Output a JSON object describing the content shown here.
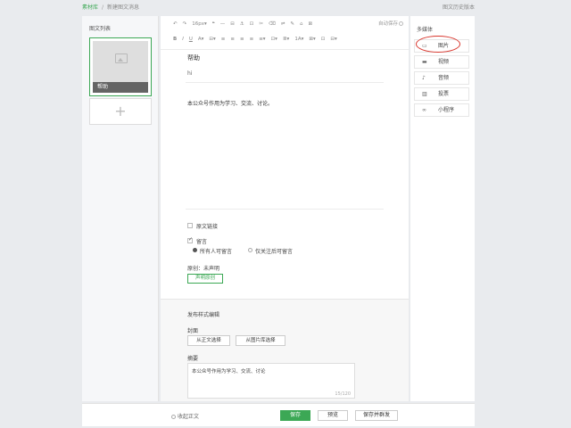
{
  "breadcrumb": {
    "root": "素材库",
    "separator": "/",
    "current": "新建图文消息"
  },
  "history_link": "图文历史版本",
  "left_panel": {
    "title": "图文列表",
    "thumb_label": "帮助",
    "add_symbol": "+"
  },
  "toolbar": {
    "row1": [
      "↶",
      "↷",
      "16px▾",
      "❝",
      "—",
      "⊟",
      "⚓",
      "⊡",
      "✂",
      "⌫",
      "⇌",
      "✎",
      "⌂",
      "⊠"
    ],
    "row2": [
      "B",
      "I",
      "U",
      "A▾",
      "⊟▾",
      "≡",
      "≡",
      "≡",
      "≡",
      "≡▾",
      "⊡▾",
      "≣▾",
      "1A▾",
      "⊠▾",
      "⊡",
      "⊟▾"
    ],
    "autosave": "自动保存"
  },
  "article": {
    "title": "帮助",
    "author": "hi",
    "body": "本公众号作用为学习、交流、讨论。"
  },
  "options": {
    "original_link": "原文链接",
    "comment": "留言",
    "comment_all": "所有人可留言",
    "comment_follow": "仅关注后可留言",
    "original_status": "原创：未声明",
    "declare_btn": "声明原创"
  },
  "publish": {
    "title": "发布样式编辑",
    "cover_label": "封面",
    "cover_from_body": "从正文选择",
    "cover_from_lib": "从图片库选择",
    "summary_label": "摘要",
    "summary_text": "本公众号作用为学习、交流、讨论",
    "summary_count": "15/120"
  },
  "media": {
    "title": "多媒体",
    "items": [
      {
        "icon": "▭",
        "label": "图片"
      },
      {
        "icon": "▬",
        "label": "视频"
      },
      {
        "icon": "♪",
        "label": "音频"
      },
      {
        "icon": "▥",
        "label": "投票"
      },
      {
        "icon": "∞",
        "label": "小程序"
      }
    ]
  },
  "footer": {
    "collapse": "收起正文",
    "save": "保存",
    "preview": "预览",
    "save_send": "保存并群发"
  },
  "colors": {
    "accent": "#3ca855",
    "annotation": "#d9372e",
    "background": "#e9ebee"
  }
}
